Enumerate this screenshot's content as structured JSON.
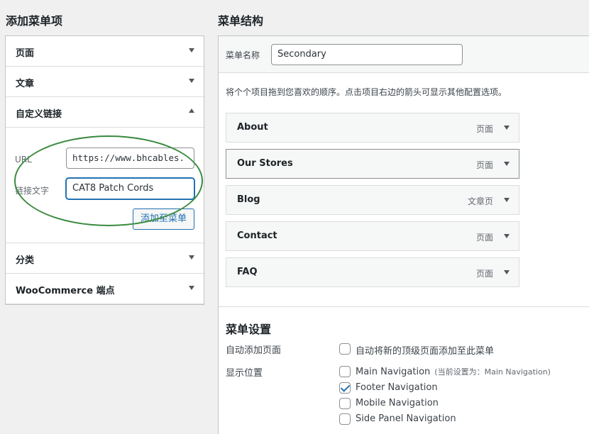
{
  "add_menu_items": {
    "heading": "添加菜单项",
    "sections": {
      "pages": "页面",
      "posts": "文章",
      "custom_links": "自定义链接",
      "categories": "分类",
      "woocommerce": "WooCommerce 端点"
    },
    "custom_link": {
      "url_label": "URL",
      "url_value": "https://www.bhcables.",
      "link_text_label": "链接文字",
      "link_text_value": "CAT8 Patch Cords",
      "add_button": "添加至菜单"
    }
  },
  "menu_structure": {
    "heading": "菜单结构",
    "name_label": "菜单名称",
    "name_value": "Secondary",
    "instructions": "将个个项目拖到您喜欢的顺序。点击项目右边的箭头可显示其他配置选项。",
    "items": [
      {
        "title": "About",
        "type": "页面"
      },
      {
        "title": "Our Stores",
        "type": "页面"
      },
      {
        "title": "Blog",
        "type": "文章页"
      },
      {
        "title": "Contact",
        "type": "页面"
      },
      {
        "title": "FAQ",
        "type": "页面"
      }
    ]
  },
  "menu_settings": {
    "heading": "菜单设置",
    "auto_add_label": "自动添加页面",
    "auto_add_option": "自动将新的顶级页面添加至此菜单",
    "auto_add_checked": false,
    "display_label": "显示位置",
    "locations": [
      {
        "name": "Main Navigation",
        "note": "(当前设置为：Main Navigation)",
        "checked": false
      },
      {
        "name": "Footer Navigation",
        "note": "",
        "checked": true
      },
      {
        "name": "Mobile Navigation",
        "note": "",
        "checked": false
      },
      {
        "name": "Side Panel Navigation",
        "note": "",
        "checked": false
      }
    ]
  },
  "colors": {
    "accent": "#2271b1",
    "annotation": "#3a8a3e"
  }
}
